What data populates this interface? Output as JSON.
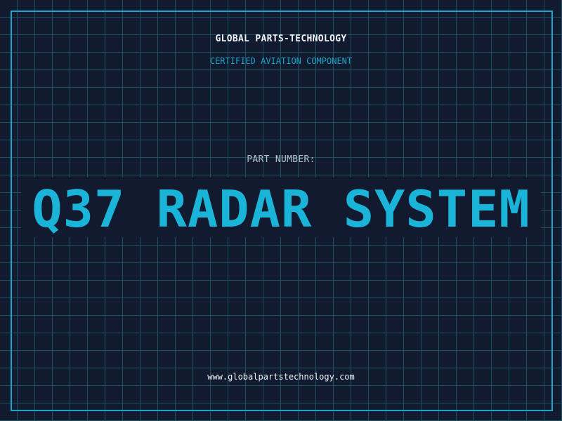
{
  "brand": {
    "name": "GLOBAL PARTS-TECHNOLOGY",
    "tagline": "CERTIFIED AVIATION COMPONENT"
  },
  "part": {
    "label": "PART NUMBER:",
    "name": "Q37 RADAR SYSTEM"
  },
  "footer": {
    "url": "www.globalpartstechnology.com"
  },
  "colors": {
    "background": "#111a2e",
    "grid": "#1d4f5e",
    "accent": "#1aa6c8",
    "headline": "#1ab4d8",
    "text": "#f0f4f8"
  }
}
